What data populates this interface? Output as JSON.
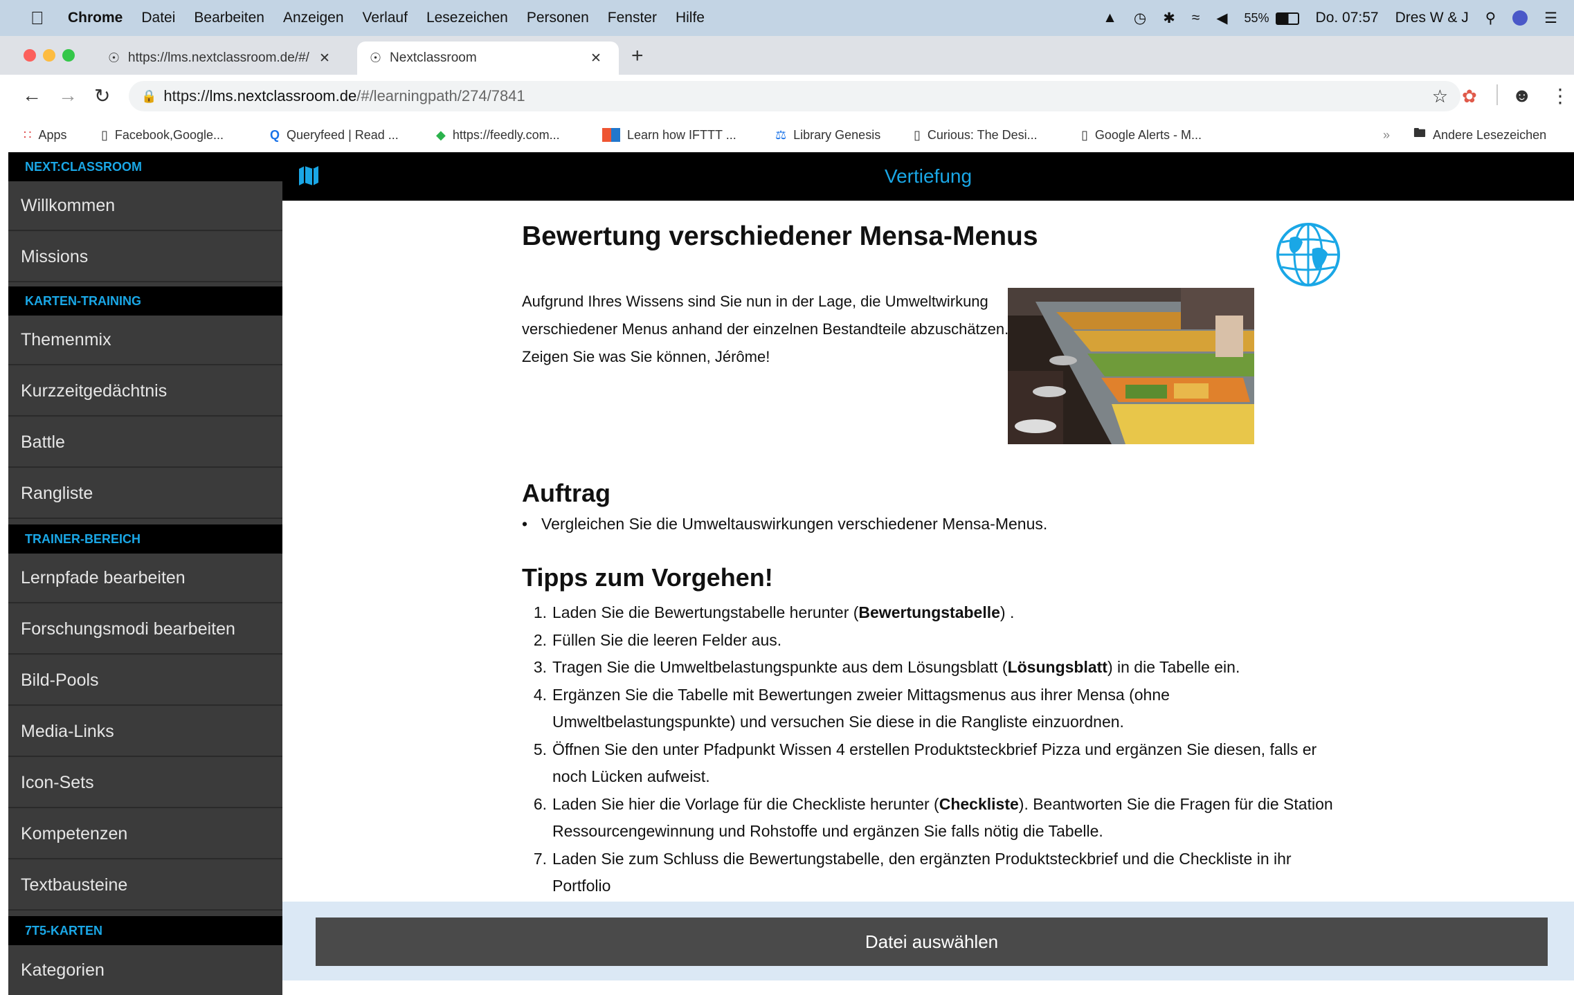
{
  "menubar": {
    "items": [
      "Chrome",
      "Datei",
      "Bearbeiten",
      "Anzeigen",
      "Verlauf",
      "Lesezeichen",
      "Personen",
      "Fenster",
      "Hilfe"
    ],
    "battery": "55%",
    "clock": "Do. 07:57",
    "user": "Dres W & J"
  },
  "tabs": [
    {
      "title": "https://lms.nextclassroom.de/#/"
    },
    {
      "title": "Nextclassroom"
    }
  ],
  "toolbar": {
    "url_prefix": "https://",
    "url_host": "lms.nextclassroom.de",
    "url_path": "/#/learningpath/274/7841"
  },
  "bookmarks": {
    "items": [
      "Apps",
      "Facebook,Google...",
      "Queryfeed | Read ...",
      "https://feedly.com...",
      "Learn how IFTTT ...",
      "Library Genesis",
      "Curious: The Desi...",
      "Google Alerts - M..."
    ],
    "more": "»",
    "other": "Andere Lesezeichen"
  },
  "sidebar": {
    "sections": [
      {
        "heading": "NEXT:CLASSROOM",
        "items": [
          "Willkommen",
          "Missions"
        ]
      },
      {
        "heading": "KARTEN-TRAINING",
        "items": [
          "Themenmix",
          "Kurzzeitgedächtnis",
          "Battle",
          "Rangliste"
        ]
      },
      {
        "heading": "TRAINER-BEREICH",
        "items": [
          "Lernpfade bearbeiten",
          "Forschungsmodi bearbeiten",
          "Bild-Pools",
          "Media-Links",
          "Icon-Sets",
          "Kompetenzen",
          "Textbausteine"
        ]
      },
      {
        "heading": "7T5-KARTEN",
        "items": [
          "Kategorien"
        ]
      }
    ]
  },
  "topbar": {
    "title": "Vertiefung"
  },
  "content": {
    "title": "Bewertung verschiedener Mensa-Menus",
    "intro": "Aufgrund Ihres Wissens sind Sie nun in der Lage, die Umweltwirkung verschiedener Menus anhand der einzelnen Bestandteile abzuschätzen. Zeigen Sie was Sie können, Jérôme!",
    "auftrag_heading": "Auftrag",
    "auftrag_items": [
      "Vergleichen Sie die Umweltauswirkungen verschiedener Mensa-Menus."
    ],
    "tipps_heading": "Tipps zum Vorgehen!",
    "tipps": [
      {
        "pre": "Laden Sie die Bewertungstabelle herunter (",
        "bold": "Bewertungstabelle",
        "post": ") ."
      },
      {
        "pre": "Füllen Sie die leeren Felder aus.",
        "bold": "",
        "post": ""
      },
      {
        "pre": "Tragen Sie die Umweltbelastungspunkte aus dem Lösungsblatt (",
        "bold": "Lösungsblatt",
        "post": ") in die Tabelle ein."
      },
      {
        "pre": "Ergänzen Sie die Tabelle mit Bewertungen zweier Mittagsmenus aus ihrer Mensa (ohne Umweltbelastungspunkte) und versuchen Sie diese in die Rangliste einzuordnen.",
        "bold": "",
        "post": ""
      },
      {
        "pre": "Öffnen Sie den unter Pfadpunkt Wissen 4 erstellen Produktsteckbrief Pizza und ergänzen Sie diesen, falls er noch Lücken aufweist.",
        "bold": "",
        "post": ""
      },
      {
        "pre": "Laden Sie hier die Vorlage für die Checkliste herunter (",
        "bold": "Checkliste",
        "post": "). Beantworten Sie die Fragen für die Station Ressourcengewinnung und Rohstoffe und ergänzen Sie falls nötig die Tabelle."
      },
      {
        "pre": "Laden Sie zum Schluss die Bewertungstabelle, den ergänzten Produktsteckbrief und die Checkliste in ihr Portfolio",
        "bold": "",
        "post": ""
      }
    ],
    "file_button": "Datei auswählen"
  },
  "colors": {
    "accent": "#1aa7e6",
    "sidebar": "#3a3a3a",
    "button": "#4a4a4a"
  }
}
